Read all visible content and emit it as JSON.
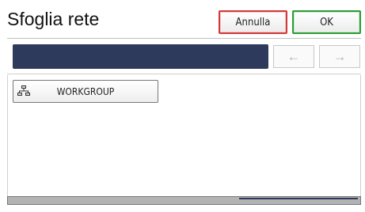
{
  "header": {
    "title": "Sfoglia rete",
    "cancel_label": "Annulla",
    "ok_label": "OK"
  },
  "path_bar": {
    "value": ""
  },
  "navigation": {
    "back_symbol": "←",
    "forward_symbol": "→"
  },
  "list": {
    "items": [
      {
        "label": "WORKGROUP",
        "icon": "network-group-icon"
      }
    ]
  },
  "colors": {
    "cancel_border": "#d23a3a",
    "ok_border": "#2f9a3a",
    "path_bar": "#2d3a5c"
  }
}
